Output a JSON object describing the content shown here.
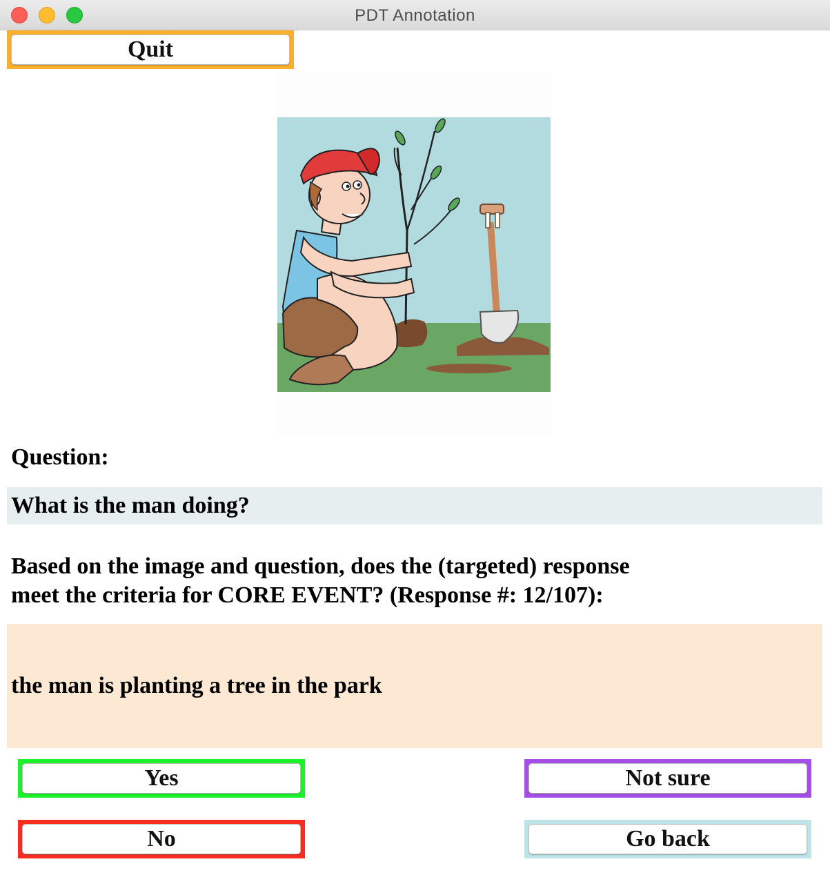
{
  "window": {
    "title": "PDT Annotation"
  },
  "toolbar": {
    "quit_label": "Quit"
  },
  "question": {
    "heading": "Question:",
    "text": "What is the man doing?"
  },
  "prompt": {
    "line1": "Based on the image and question, does the (targeted) response",
    "line2": "meet the criteria for CORE EVENT? (Response #: 12/107):"
  },
  "response": {
    "text": "the man is planting a tree in the park"
  },
  "answers": {
    "yes_label": "Yes",
    "not_sure_label": "Not sure",
    "no_label": "No",
    "go_back_label": "Go back"
  },
  "colors": {
    "quit_frame": "#fcaf2c",
    "yes_frame": "#1cf22a",
    "not_sure_frame": "#a64ee8",
    "no_frame": "#f62e22",
    "go_back_frame": "#bde4e8",
    "question_bg": "#e6eef0",
    "response_bg": "#fde8d4"
  }
}
